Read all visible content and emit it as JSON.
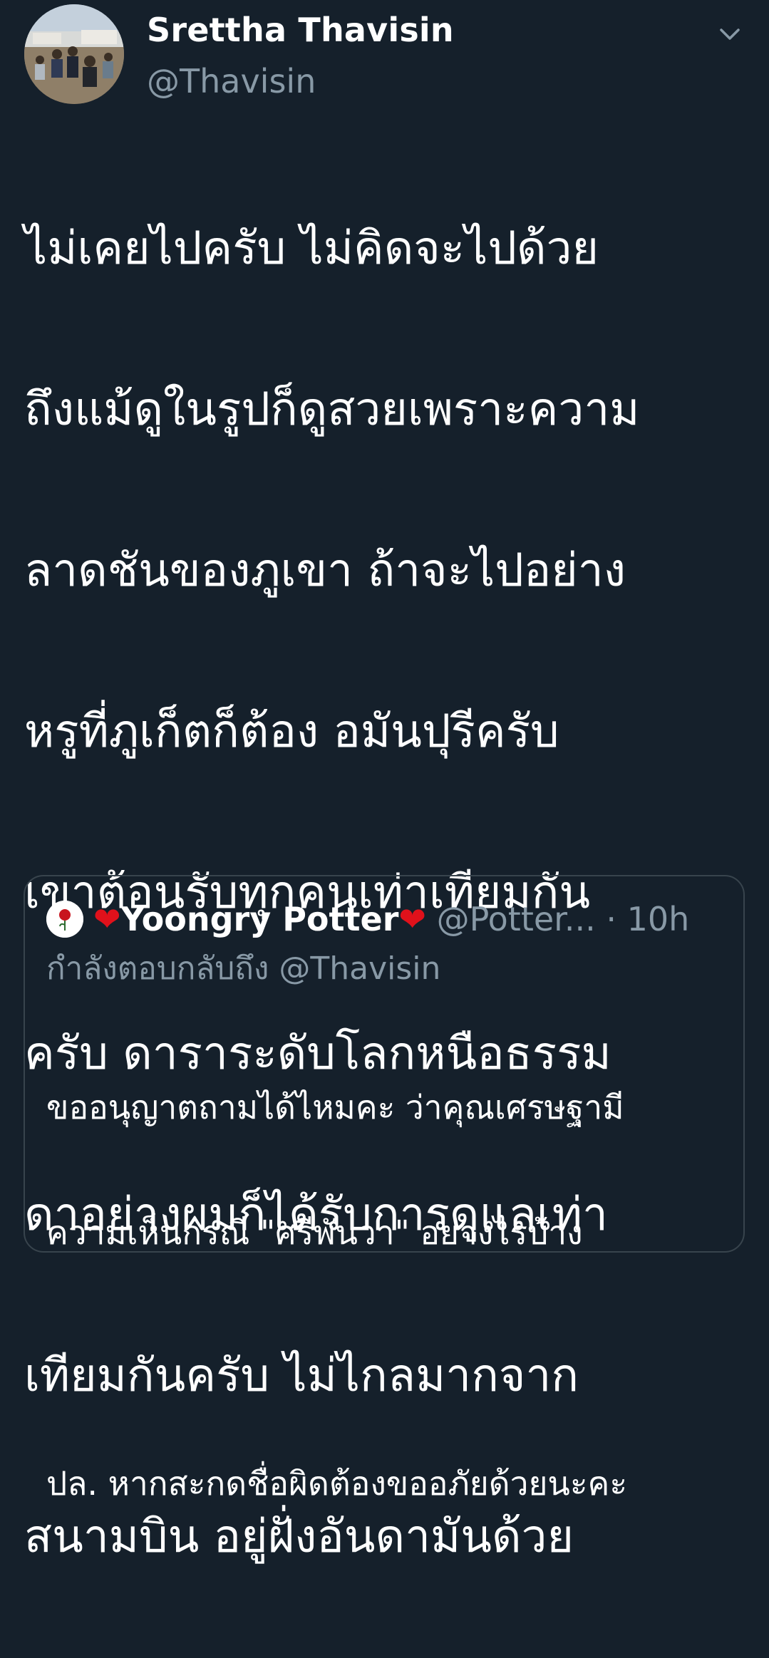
{
  "tweet": {
    "author": {
      "display_name": "Srettha Thavisin",
      "handle": "@Thavisin",
      "avatar_icon": "profile-photo"
    },
    "menu_icon": "chevron-down-icon",
    "text_lines": [
      "ไม่เคยไปครับ ไม่คิดจะไปด้วย",
      "ถึงแม้ดูในรูปก็ดูสวยเพราะความ",
      "ลาดชันของภูเขา ถ้าจะไปอย่าง",
      "หรูที่ภูเก็ตก็ต้อง อมันปุรีครับ",
      "เขาต้อนรับทุกคนเท่าเทียมกัน",
      "ครับ ดาราระดับโลกหนือธรรม",
      "ดาอย่างผมก็ได้รับการดูแลเท่า",
      "เทียมกันครับ ไม่ไกลมากจาก",
      "สนามบิน อยู่ฝั่งอันดามันด้วย"
    ]
  },
  "quoted": {
    "heart_left": "❤",
    "display_name": "Yoongry Potter",
    "heart_right": "❤",
    "handle": "@Potter...",
    "dot": "·",
    "time": "10h",
    "reply_to_label": "กำลังตอบกลับถึง",
    "reply_to_handle": "@Thavisin",
    "text_lines": [
      "ขออนุญาตถามได้ไหมคะ ว่าคุณเศรษฐามี",
      "ความเห็นกรณี \"ศรีพันวา\" อย่างไรบ้าง",
      "",
      "ปล. หากสะกดชื่อผิดต้องขออภัยด้วยนะคะ"
    ]
  },
  "colors": {
    "background": "#15202b",
    "text": "#ffffff",
    "secondary_text": "#8899a6",
    "border": "#38444d",
    "heart": "#e0111b"
  }
}
